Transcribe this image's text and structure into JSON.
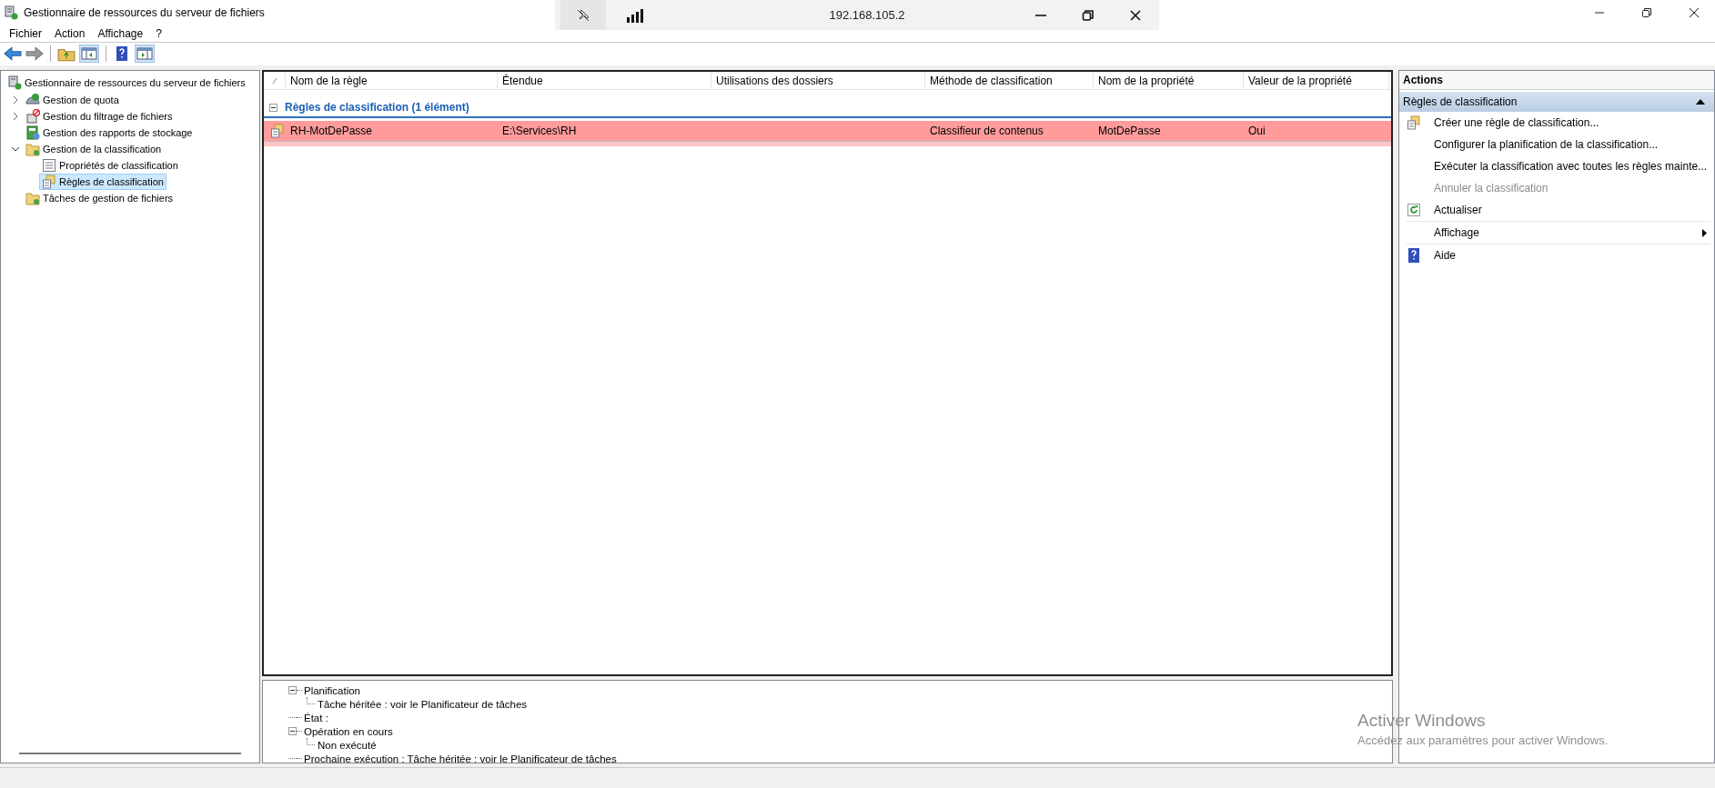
{
  "window": {
    "title": "Gestionnaire de ressources du serveur de fichiers"
  },
  "remote_bar": {
    "address": "192.168.105.2"
  },
  "menu": [
    {
      "label": "Fichier"
    },
    {
      "label": "Action"
    },
    {
      "label": "Affichage"
    },
    {
      "label": "?"
    }
  ],
  "tree": [
    {
      "label": "Gestionnaire de ressources du serveur de fichiers",
      "selected": false,
      "children": [
        {
          "label": "Gestion de quota",
          "kind": "quota",
          "expanded": false,
          "selected": false
        },
        {
          "label": "Gestion du filtrage de fichiers",
          "kind": "filter",
          "expanded": false,
          "selected": false
        },
        {
          "label": "Gestion des rapports de stockage",
          "kind": "report",
          "selected": false
        },
        {
          "label": "Gestion de la classification",
          "kind": "folder",
          "expanded": true,
          "selected": false,
          "children": [
            {
              "label": "Propriétés de classification",
              "kind": "list",
              "selected": false
            },
            {
              "label": "Règles de classification",
              "kind": "rules",
              "selected": true
            }
          ]
        },
        {
          "label": "Tâches de gestion de fichiers",
          "kind": "folder",
          "selected": false
        }
      ]
    }
  ],
  "table": {
    "columns": [
      "Nom de la règle",
      "Étendue",
      "Utilisations des dossiers",
      "Méthode de classification",
      "Nom de la propriété",
      "Valeur de la propriété"
    ],
    "group": {
      "label": "Règles de classification (1 élément)",
      "expanded": true
    },
    "rows": [
      {
        "selected": true,
        "cells": [
          "RH-MotDePasse",
          "E:\\Services\\RH",
          "",
          "Classifieur de contenus",
          "MotDePasse",
          "Oui"
        ]
      }
    ]
  },
  "details": [
    {
      "label": "Planification",
      "expanded": true,
      "children": [
        {
          "label": "Tâche héritée : voir le Planificateur de tâches"
        }
      ]
    },
    {
      "label": "État :"
    },
    {
      "label": "Opération en cours",
      "expanded": true,
      "children": [
        {
          "label": "Non exécuté"
        }
      ]
    },
    {
      "label": "Prochaine exécution : Tâche héritée : voir le Planificateur de tâches"
    }
  ],
  "actions": {
    "title": "Actions",
    "group": {
      "label": "Règles de classification",
      "expanded": true
    },
    "items": [
      {
        "label": "Créer une règle de classification...",
        "kind": "create",
        "disabled": false
      },
      {
        "label": "Configurer la planification de la classification...",
        "kind": "plain",
        "disabled": false
      },
      {
        "label": "Exécuter la classification avec toutes les règles mainte...",
        "kind": "plain",
        "disabled": false
      },
      {
        "label": "Annuler la classification",
        "kind": "plain",
        "disabled": true
      },
      {
        "label": "Actualiser",
        "kind": "refresh",
        "disabled": false
      },
      {
        "label": "Affichage",
        "kind": "submenu",
        "disabled": false
      },
      {
        "label": "Aide",
        "kind": "help",
        "disabled": false
      }
    ]
  },
  "activation_notice": {
    "title": "Activer Windows",
    "message": "Accédez aux paramètres pour activer Windows."
  }
}
